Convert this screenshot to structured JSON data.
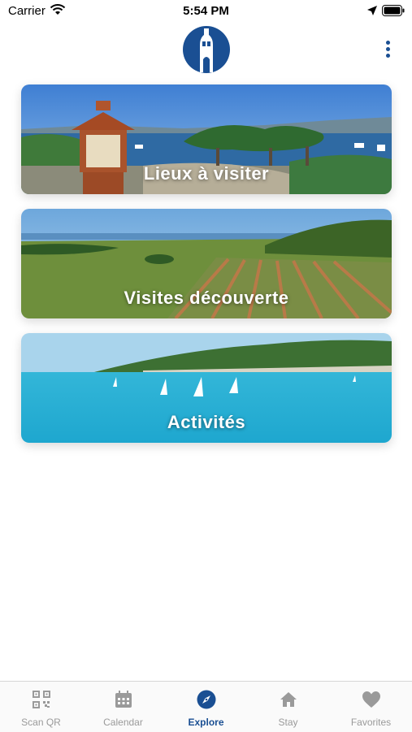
{
  "status": {
    "carrier": "Carrier",
    "time": "5:54 PM"
  },
  "colors": {
    "brand": "#1a4f93",
    "inactive": "#9a9a9a"
  },
  "cards": [
    {
      "title": "Lieux à visiter"
    },
    {
      "title": "Visites découverte"
    },
    {
      "title": "Activités"
    }
  ],
  "tabs": [
    {
      "label": "Scan QR",
      "icon": "qr-code-icon"
    },
    {
      "label": "Calendar",
      "icon": "calendar-icon"
    },
    {
      "label": "Explore",
      "icon": "compass-icon",
      "active": true
    },
    {
      "label": "Stay",
      "icon": "home-icon"
    },
    {
      "label": "Favorites",
      "icon": "heart-icon"
    }
  ]
}
